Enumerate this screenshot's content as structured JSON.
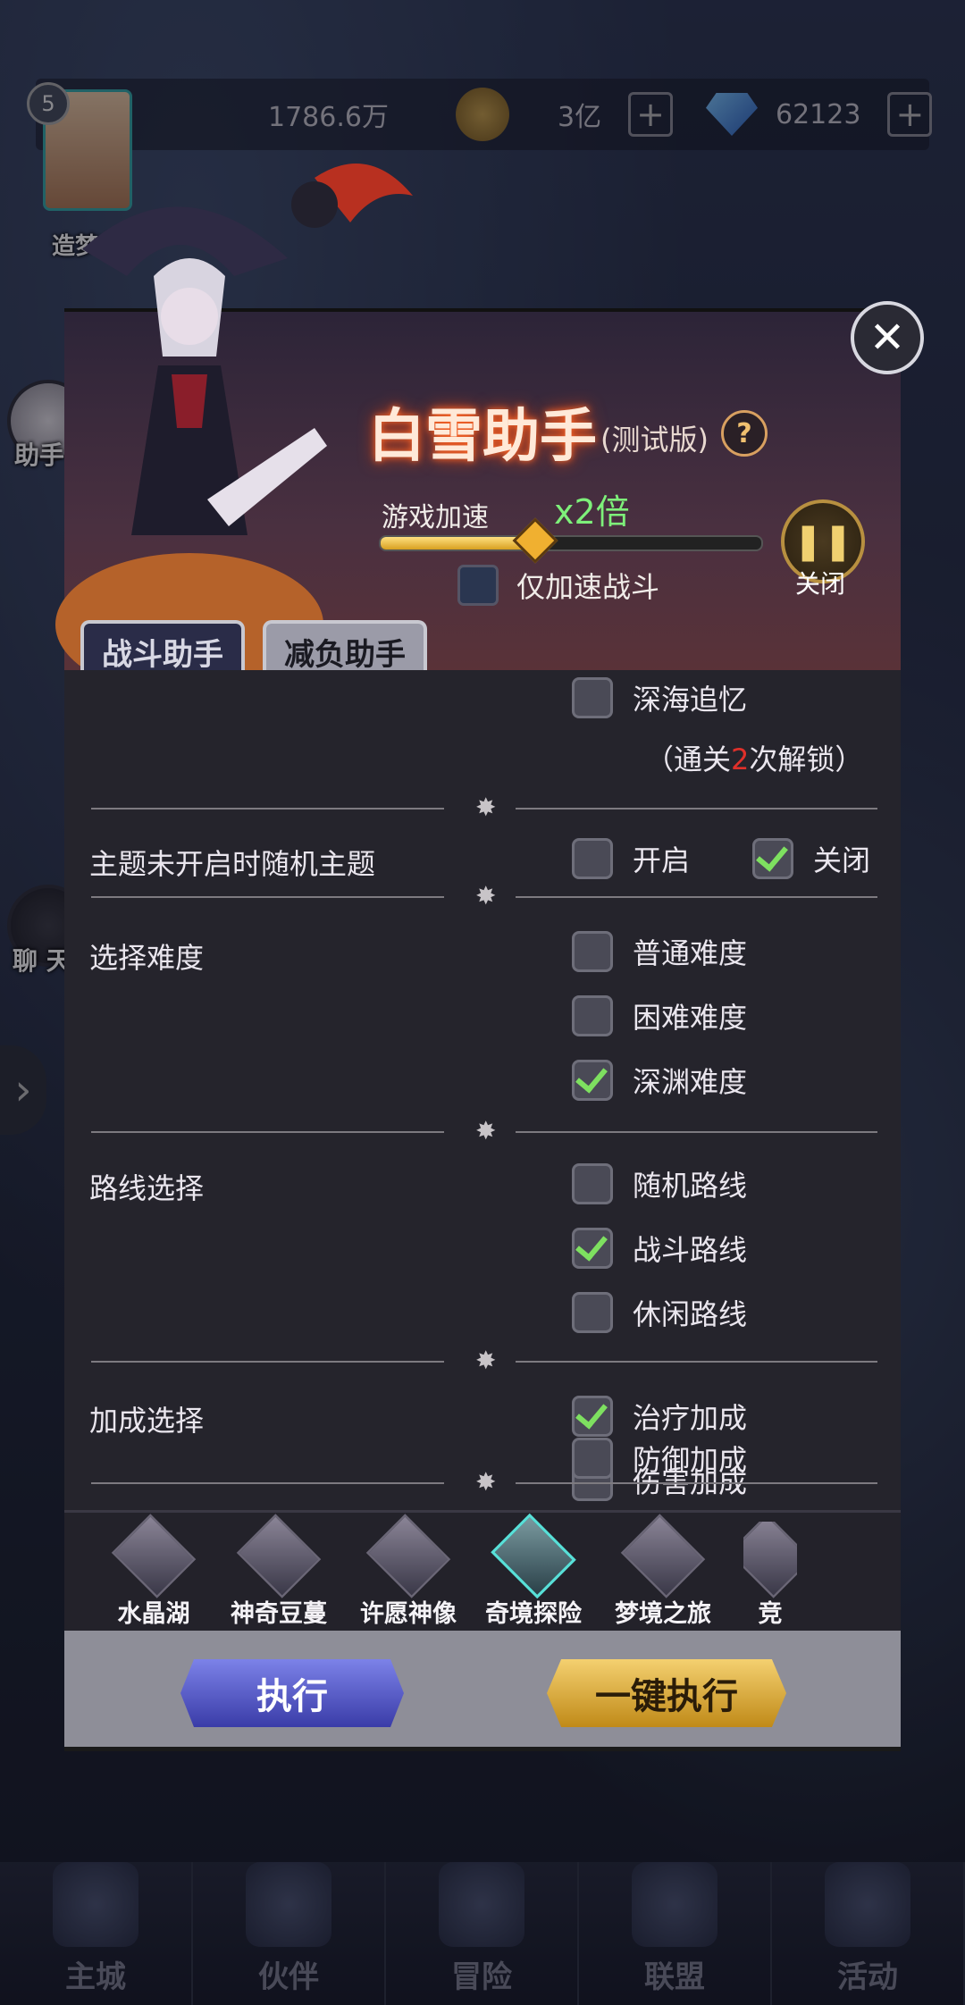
{
  "resources": {
    "power": "1786.6万",
    "gold": "3亿",
    "diamonds": "62123",
    "player_level": "5",
    "player_rank": "造梦者"
  },
  "sidebar": {
    "assistant_label": "助手",
    "chat_label": "聊 天"
  },
  "panel": {
    "title": "白雪助手",
    "subtitle": "(测试版)",
    "help_icon": "?",
    "speed_label": "游戏加速",
    "speed_value": "x2倍",
    "speed_level": 0.4,
    "battle_only_label": "仅加速战斗",
    "pause_label": "关闭",
    "tabs": [
      {
        "label": "战斗助手"
      },
      {
        "label": "减负助手"
      }
    ]
  },
  "settings": {
    "partial_option": "深海追忆",
    "unlock_prefix": "（通关",
    "unlock_count": "2",
    "unlock_suffix": "次解锁）",
    "random_theme": {
      "label": "主题未开启时随机主题",
      "on_label": "开启",
      "off_label": "关闭"
    },
    "difficulty": {
      "label": "选择难度",
      "options": [
        "普通难度",
        "困难难度",
        "深渊难度"
      ]
    },
    "route": {
      "label": "路线选择",
      "options": [
        "随机路线",
        "战斗路线",
        "休闲路线"
      ]
    },
    "bonus": {
      "label": "加成选择",
      "options": [
        "治疗加成",
        "伤害加成",
        "防御加成"
      ]
    }
  },
  "modes": [
    {
      "label": "水晶湖"
    },
    {
      "label": "神奇豆蔓"
    },
    {
      "label": "许愿神像"
    },
    {
      "label": "奇境探险"
    },
    {
      "label": "梦境之旅"
    },
    {
      "label": "竞"
    }
  ],
  "actions": {
    "run_label": "执行",
    "run_all_label": "一键执行"
  },
  "bottom_nav": [
    {
      "label": "主城"
    },
    {
      "label": "伙伴"
    },
    {
      "label": "冒险"
    },
    {
      "label": "联盟"
    },
    {
      "label": "活动"
    }
  ],
  "colors": {
    "check_green": "#7ee060",
    "lock_red": "#e0302a",
    "speed_green": "#7ef07a",
    "run_button": "#5a5ec8",
    "run_all_button": "#e0b040"
  }
}
